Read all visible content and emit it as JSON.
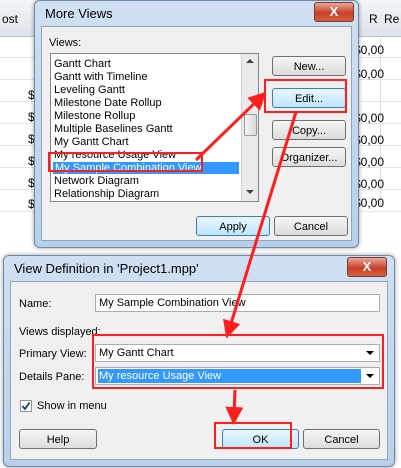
{
  "sheet": {
    "headers": [
      "ost",
      "R",
      "Re"
    ],
    "cells": [
      "$0,00",
      "$0,00",
      "$0,00",
      "$0,00",
      "$0,00",
      "$0,00",
      "$0,00"
    ],
    "dollars": [
      "$",
      "$",
      "$",
      "$",
      "$",
      "$"
    ]
  },
  "more_views": {
    "title": "More Views",
    "close_label": "X",
    "views_label": "Views:",
    "items": [
      "Gantt Chart",
      "Gantt with Timeline",
      "Leveling Gantt",
      "Milestone Date Rollup",
      "Milestone Rollup",
      "Multiple Baselines Gantt",
      "My Gantt Chart",
      "My resource Usage View",
      "My Sample Combination View",
      "Network Diagram",
      "Relationship Diagram"
    ],
    "selected": "My Sample Combination View",
    "buttons": {
      "new": "New...",
      "edit": "Edit...",
      "copy": "Copy...",
      "organizer": "Organizer...",
      "apply": "Apply",
      "cancel": "Cancel"
    }
  },
  "view_def": {
    "title": "View Definition in 'Project1.mpp'",
    "close_label": "X",
    "name_label": "Name:",
    "name_value": "My Sample Combination View",
    "views_displayed_label": "Views displayed:",
    "primary_label": "Primary View:",
    "primary_value": "My Gantt Chart",
    "details_label": "Details Pane:",
    "details_value": "My resource Usage View",
    "show_in_menu_label": "Show in menu",
    "buttons": {
      "help": "Help",
      "ok": "OK",
      "cancel": "Cancel"
    }
  },
  "colors": {
    "annotation": "#ff1e1e",
    "selection": "#3399ff"
  }
}
